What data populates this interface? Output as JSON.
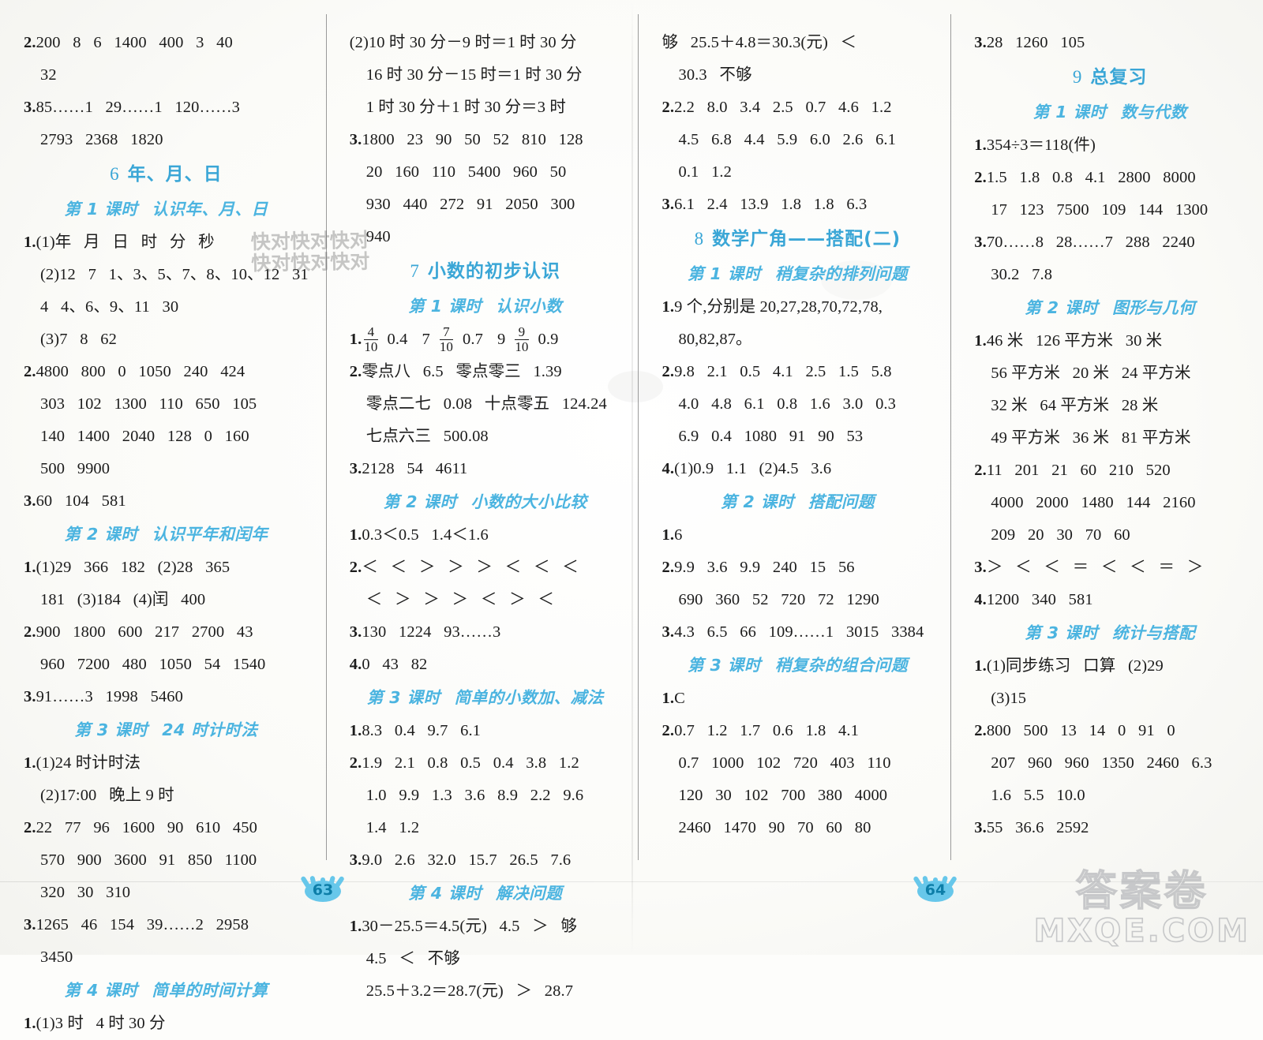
{
  "colors": {
    "heading_blue": "#4bb4e0",
    "unit_blue": "#3aa6d6",
    "page_num": "#0d7ea8",
    "text": "#1c1c1c"
  },
  "watermarks": {
    "tiling": "快对快对快对\n快对快对快对",
    "brand_line1": "答案卷",
    "brand_line2": "MXQE.COM"
  },
  "pages": {
    "left": "63",
    "right": "64"
  },
  "columns": [
    {
      "id": "col-1",
      "blocks": [
        {
          "type": "answer",
          "lines": [
            "2.200   8   6   1400   400   3   40",
            "32"
          ]
        },
        {
          "type": "answer",
          "lines": [
            "3.85……1   29……1   120……3",
            "2793   2368   1820"
          ]
        },
        {
          "type": "unit",
          "number": "6",
          "title": "年、月、日"
        },
        {
          "type": "lesson",
          "number": "第 1 课时",
          "title": "认识年、月、日"
        },
        {
          "type": "answer",
          "lines": [
            "1.(1)年   月   日   时   分   秒",
            "(2)12   7   1、3、5、7、8、10、12   31",
            "4   4、6、9、11   30",
            "(3)7   8   62"
          ]
        },
        {
          "type": "answer",
          "lines": [
            "2.4800   800   0   1050   240   424",
            "303   102   1300   110   650   105",
            "140   1400   2040   128   0   160",
            "500   9900"
          ]
        },
        {
          "type": "answer",
          "lines": [
            "3.60   104   581"
          ]
        },
        {
          "type": "lesson",
          "number": "第 2 课时",
          "title": "认识平年和闰年"
        },
        {
          "type": "answer",
          "lines": [
            "1.(1)29   366   182   (2)28   365",
            "181   (3)184   (4)闰   400"
          ]
        },
        {
          "type": "answer",
          "lines": [
            "2.900   1800   600   217   2700   43",
            "960   7200   480   1050   54   1540"
          ]
        },
        {
          "type": "answer",
          "lines": [
            "3.91……3   1998   5460"
          ]
        },
        {
          "type": "lesson",
          "number": "第 3 课时",
          "title": "24 时计时法"
        },
        {
          "type": "answer",
          "lines": [
            "1.(1)24 时计时法",
            "(2)17:00   晚上 9 时"
          ]
        },
        {
          "type": "answer",
          "lines": [
            "2.22   77   96   1600   90   610   450",
            "570   900   3600   91   850   1100",
            "320   30   310"
          ]
        },
        {
          "type": "answer",
          "lines": [
            "3.1265   46   154   39……2   2958",
            "3450"
          ]
        },
        {
          "type": "lesson",
          "number": "第 4 课时",
          "title": "简单的时间计算"
        },
        {
          "type": "answer",
          "lines": [
            "1.(1)3 时   4 时 30 分"
          ]
        }
      ]
    },
    {
      "id": "col-2",
      "blocks": [
        {
          "type": "answer",
          "lines": [
            "(2)10 时 30 分－9 时＝1 时 30 分",
            "16 时 30 分－15 时＝1 时 30 分",
            "1 时 30 分＋1 时 30 分＝3 时"
          ]
        },
        {
          "type": "answer",
          "lines": [
            "3.1800   23   90   50   52   810   128",
            "20   160   110   5400   960   50",
            "930   440   272   91   2050   300",
            "940"
          ]
        },
        {
          "type": "unit",
          "number": "7",
          "title": "小数的初步认识"
        },
        {
          "type": "lesson",
          "number": "第 1 课时",
          "title": "认识小数"
        },
        {
          "type": "fraction_line",
          "prefix": "1.",
          "items": [
            {
              "kind": "frac",
              "n": "4",
              "d": "10"
            },
            {
              "kind": "text",
              "v": "0.4"
            },
            {
              "kind": "text",
              "v": "7"
            },
            {
              "kind": "frac",
              "n": "7",
              "d": "10"
            },
            {
              "kind": "text",
              "v": "0.7"
            },
            {
              "kind": "text",
              "v": "9"
            },
            {
              "kind": "frac",
              "n": "9",
              "d": "10"
            },
            {
              "kind": "text",
              "v": "0.9"
            }
          ]
        },
        {
          "type": "answer",
          "lines": [
            "2.零点八   6.5   零点零三   1.39",
            "零点二七   0.08   十点零五   124.24",
            "七点六三   500.08"
          ]
        },
        {
          "type": "answer",
          "lines": [
            "3.2128   54   4611"
          ]
        },
        {
          "type": "lesson",
          "number": "第 2 课时",
          "title": "小数的大小比较"
        },
        {
          "type": "answer",
          "lines": [
            "1.0.3＜0.5   1.4＜1.6"
          ]
        },
        {
          "type": "answer",
          "lines": [
            "2.＜   ＜   ＞   ＞   ＞   ＜   ＜   ＜",
            "＜   ＞   ＞   ＞   ＜   ＞   ＜"
          ]
        },
        {
          "type": "answer",
          "lines": [
            "3.130   1224   93……3"
          ]
        },
        {
          "type": "answer",
          "lines": [
            "4.0   43   82"
          ]
        },
        {
          "type": "lesson",
          "number": "第 3 课时",
          "title": "简单的小数加、减法"
        },
        {
          "type": "answer",
          "lines": [
            "1.8.3   0.4   9.7   6.1"
          ]
        },
        {
          "type": "answer",
          "lines": [
            "2.1.9   2.1   0.8   0.5   0.4   3.8   1.2",
            "1.0   9.9   1.3   3.6   8.9   2.2   9.6",
            "1.4   1.2"
          ]
        },
        {
          "type": "answer",
          "lines": [
            "3.9.0   2.6   32.0   15.7   26.5   7.6"
          ]
        },
        {
          "type": "lesson",
          "number": "第 4 课时",
          "title": "解决问题"
        },
        {
          "type": "answer",
          "lines": [
            "1.30－25.5＝4.5(元)   4.5   ＞   够",
            "4.5   ＜   不够",
            "25.5＋3.2＝28.7(元)   ＞   28.7"
          ]
        }
      ]
    },
    {
      "id": "col-3",
      "blocks": [
        {
          "type": "answer",
          "lines": [
            "够   25.5＋4.8＝30.3(元)   ＜",
            "30.3   不够"
          ]
        },
        {
          "type": "answer",
          "lines": [
            "2.2.2   8.0   3.4   2.5   0.7   4.6   1.2",
            "4.5   6.8   4.4   5.9   6.0   2.6   6.1",
            "0.1   1.2"
          ]
        },
        {
          "type": "answer",
          "lines": [
            "3.6.1   2.4   13.9   1.8   1.8   6.3"
          ]
        },
        {
          "type": "unit",
          "number": "8",
          "title": "数学广角——搭配(二)"
        },
        {
          "type": "lesson",
          "number": "第 1 课时",
          "title": "稍复杂的排列问题"
        },
        {
          "type": "answer",
          "lines": [
            "1.9 个,分别是 20,27,28,70,72,78,",
            "80,82,87。"
          ]
        },
        {
          "type": "answer",
          "lines": [
            "2.9.8   2.1   0.5   4.1   2.5   1.5   5.8",
            "4.0   4.8   6.1   0.8   1.6   3.0   0.3",
            "6.9   0.4   1080   91   90   53"
          ]
        },
        {
          "type": "answer",
          "lines": [
            "4.(1)0.9   1.1   (2)4.5   3.6"
          ]
        },
        {
          "type": "lesson",
          "number": "第 2 课时",
          "title": "搭配问题"
        },
        {
          "type": "answer",
          "lines": [
            "1.6"
          ]
        },
        {
          "type": "answer",
          "lines": [
            "2.9.9   3.6   9.9   240   15   56",
            "690   360   52   720   72   1290"
          ]
        },
        {
          "type": "answer",
          "lines": [
            "3.4.3   6.5   66   109……1   3015   3384"
          ]
        },
        {
          "type": "lesson",
          "number": "第 3 课时",
          "title": "稍复杂的组合问题"
        },
        {
          "type": "answer",
          "lines": [
            "1.C"
          ]
        },
        {
          "type": "answer",
          "lines": [
            "2.0.7   1.2   1.7   0.6   1.8   4.1",
            "0.7   1000   102   720   403   110",
            "120   30   102   700   380   4000",
            "2460   1470   90   70   60   80"
          ]
        }
      ]
    },
    {
      "id": "col-4",
      "blocks": [
        {
          "type": "answer",
          "lines": [
            "3.28   1260   105"
          ]
        },
        {
          "type": "unit",
          "number": "9",
          "title": "总复习"
        },
        {
          "type": "lesson",
          "number": "第 1 课时",
          "title": "数与代数"
        },
        {
          "type": "answer",
          "lines": [
            "1.354÷3＝118(件)"
          ]
        },
        {
          "type": "answer",
          "lines": [
            "2.1.5   1.8   0.8   4.1   2800   8000",
            "17   123   7500   109   144   1300"
          ]
        },
        {
          "type": "answer",
          "lines": [
            "3.70……8   28……7   288   2240",
            "30.2   7.8"
          ]
        },
        {
          "type": "lesson",
          "number": "第 2 课时",
          "title": "图形与几何"
        },
        {
          "type": "answer",
          "lines": [
            "1.46 米   126 平方米   30 米",
            "56 平方米   20 米   24 平方米",
            "32 米   64 平方米   28 米",
            "49 平方米   36 米   81 平方米"
          ]
        },
        {
          "type": "answer",
          "lines": [
            "2.11   201   21   60   210   520",
            "4000   2000   1480   144   2160",
            "209   20   30   70   60"
          ]
        },
        {
          "type": "answer",
          "lines": [
            "3.＞   ＜   ＜   ＝   ＜   ＜   ＝   ＞"
          ]
        },
        {
          "type": "answer",
          "lines": [
            "4.1200   340   581"
          ]
        },
        {
          "type": "lesson",
          "number": "第 3 课时",
          "title": "统计与搭配"
        },
        {
          "type": "answer",
          "lines": [
            "1.(1)同步练习   口算   (2)29",
            "(3)15"
          ]
        },
        {
          "type": "answer",
          "lines": [
            "2.800   500   13   14   0   91   0",
            "207   960   960   1350   2460   6.3",
            "1.6   5.5   10.0"
          ]
        },
        {
          "type": "answer",
          "lines": [
            "3.55   36.6   2592"
          ]
        }
      ]
    }
  ]
}
